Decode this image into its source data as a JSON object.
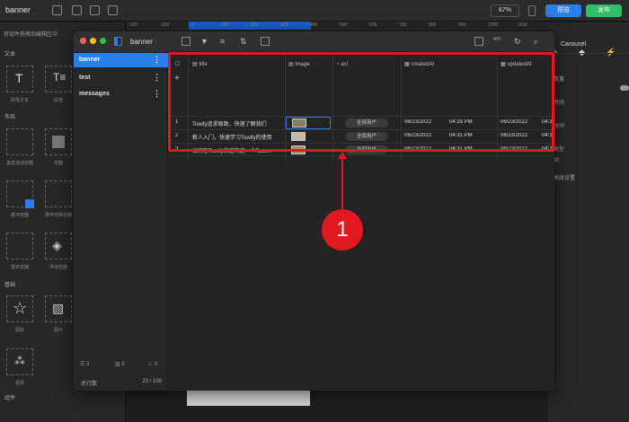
{
  "app": {
    "title": "banner",
    "zoom": "67%",
    "preview_label": "预览",
    "publish_label": "发布"
  },
  "ruler": {
    "ticks": [
      "-200",
      "-100",
      "0",
      "100",
      "200",
      "300",
      "400",
      "500",
      "600",
      "700",
      "800",
      "900",
      "1000",
      "1100"
    ]
  },
  "left_panel": {
    "hint": "将组件拖拽到编辑区中",
    "sections": [
      "文本",
      "布局",
      "基础",
      "组件"
    ],
    "components": [
      "段落文本",
      "段落",
      "垂直滚动容器",
      "容器",
      "循环容器",
      "循环切换容器",
      "重复容器",
      "浮动容器",
      "图标",
      "图片",
      "视频"
    ]
  },
  "right_panel": {
    "tab": "Carousel",
    "items": [
      "数量",
      "时间",
      "时间",
      "类型",
      "动",
      "高级设置"
    ]
  },
  "dialog": {
    "title": "banner",
    "tables": [
      {
        "name": "banner",
        "active": true
      },
      {
        "name": "test",
        "active": false
      },
      {
        "name": "messages",
        "active": false
      }
    ],
    "stats": {
      "columns": "3",
      "rows": "5",
      "links": "0"
    },
    "total_label": "总行数",
    "total_value": "23 / 100",
    "progress": 0.23,
    "columns": [
      "title",
      "image",
      "acl",
      "createdAt",
      "updatedAt"
    ],
    "rows": [
      {
        "num": "1",
        "title": "Towify追求极致，快速了解我们",
        "acl": "全部用户",
        "created_date": "06/23/2022",
        "created_time": "04:33 PM",
        "updated_date": "06/23/2022",
        "updated_time": "04:3"
      },
      {
        "num": "2",
        "title": "新人入门，快速学习Towify的使用",
        "acl": "全部用户",
        "created_date": "06/23/2022",
        "created_time": "04:31 PM",
        "updated_date": "06/23/2022",
        "updated_time": "04:3"
      },
      {
        "num": "3",
        "title": "如何在Towify快速构建一个Todo...",
        "acl": "全部用户",
        "created_date": "06/23/2022",
        "created_time": "04:31 PM",
        "updated_date": "06/23/2022",
        "updated_time": "04:3"
      }
    ]
  },
  "annotation": {
    "badge": "1"
  },
  "colors": {
    "accent": "#2a7ee8",
    "publish": "#2fbf6a",
    "highlight": "#e01820"
  }
}
